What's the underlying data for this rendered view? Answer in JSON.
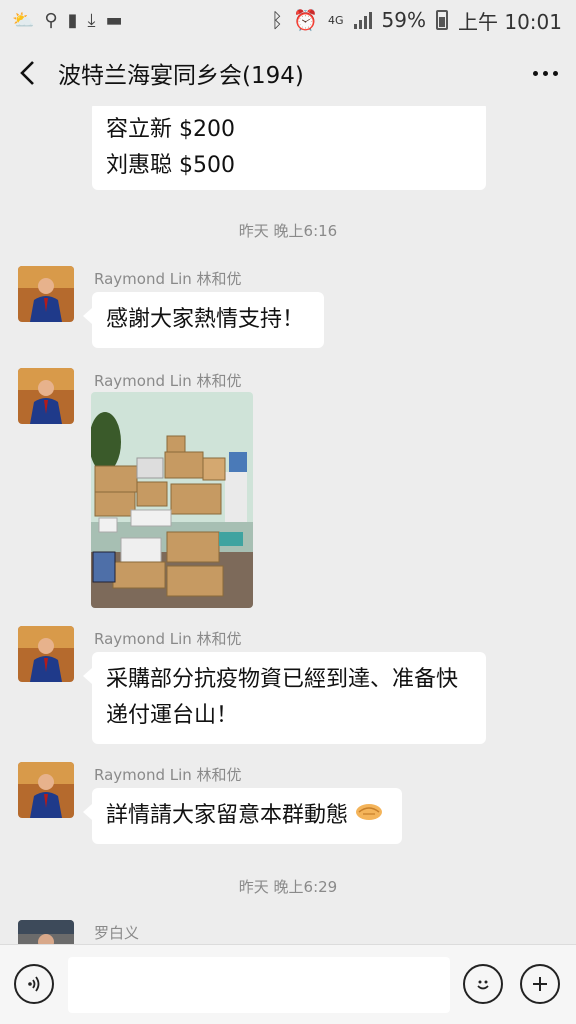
{
  "status": {
    "battery": "59%",
    "time": "上午 10:01",
    "network": "4G"
  },
  "header": {
    "title": "波特兰海宴同乡会(194)"
  },
  "messages": {
    "m0_line1": "容立新 $200",
    "m0_line2": "刘惠聪 $500",
    "time1": "昨天 晚上6:16",
    "m1_sender": "Raymond Lin 林和优",
    "m1_text": "感謝大家熱情支持！",
    "m2_sender": "Raymond Lin 林和优",
    "m3_sender": "Raymond Lin 林和优",
    "m3_text_line1": "采購部分抗疫物資已經到達、准备快",
    "m3_text_line2": "递付運台山！",
    "m4_sender": "Raymond Lin 林和优",
    "m4_text": "詳情請大家留意本群動態",
    "time2": "昨天 晚上6:29",
    "m5_sender": "罗白义"
  },
  "icons": {
    "back": "back-arrow-icon",
    "more": "more-dots-icon",
    "voice": "voice-icon",
    "emoji": "emoji-icon",
    "plus": "plus-icon",
    "handshake": "handshake-emoji"
  },
  "colors": {
    "background": "#ededed",
    "bubble": "#ffffff",
    "meta_text": "#8a8a8a",
    "title": "#111111"
  }
}
